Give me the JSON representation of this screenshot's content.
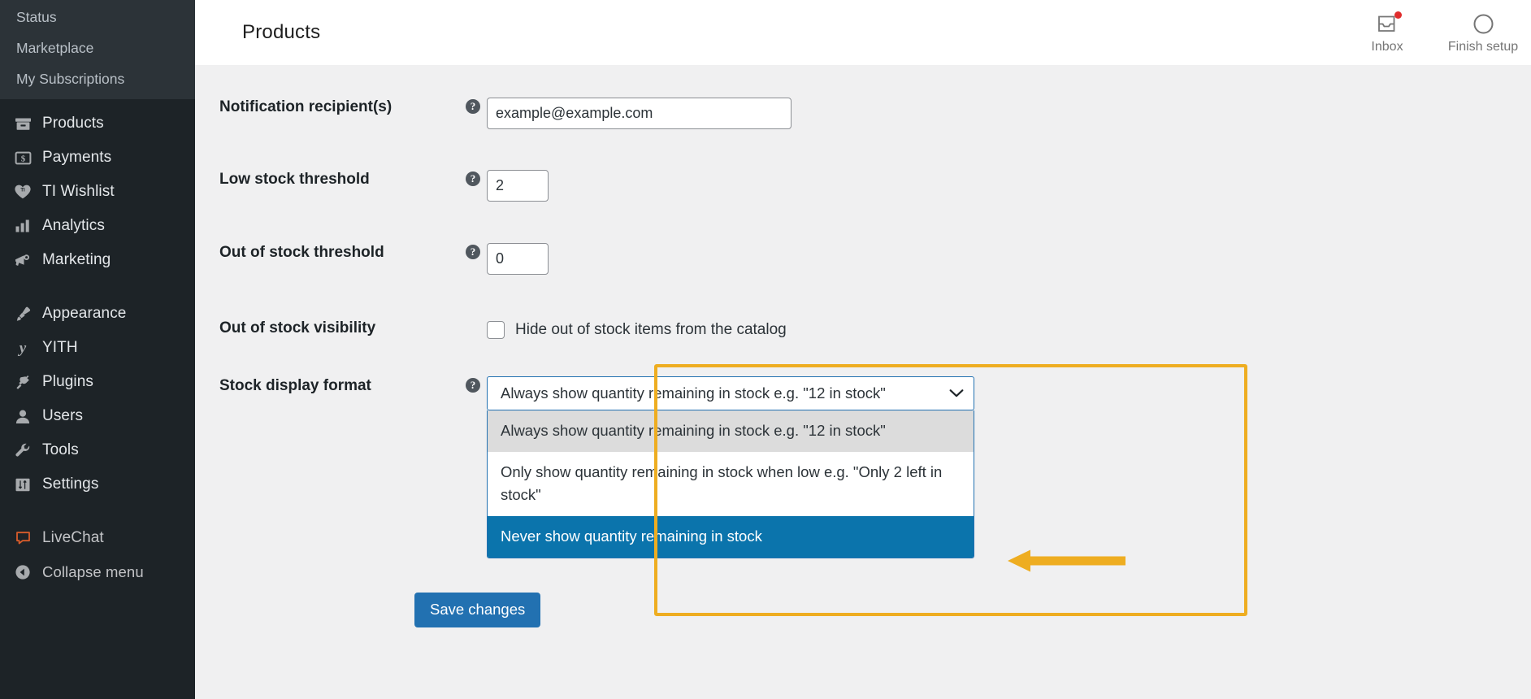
{
  "sidebar": {
    "submenu": [
      {
        "label": "Status"
      },
      {
        "label": "Marketplace"
      },
      {
        "label": "My Subscriptions"
      }
    ],
    "main_items": [
      {
        "label": "Products",
        "icon": "products-icon"
      },
      {
        "label": "Payments",
        "icon": "payments-dollar-icon"
      },
      {
        "label": "TI Wishlist",
        "icon": "heart-wishlist-icon"
      },
      {
        "label": "Analytics",
        "icon": "bar-chart-icon"
      },
      {
        "label": "Marketing",
        "icon": "megaphone-icon"
      }
    ],
    "admin_items": [
      {
        "label": "Appearance",
        "icon": "paintbrush-icon"
      },
      {
        "label": "YITH",
        "icon": "yith-logo-icon"
      },
      {
        "label": "Plugins",
        "icon": "plug-icon"
      },
      {
        "label": "Users",
        "icon": "user-icon"
      },
      {
        "label": "Tools",
        "icon": "wrench-icon"
      },
      {
        "label": "Settings",
        "icon": "sliders-icon"
      }
    ],
    "footer_items": [
      {
        "label": "LiveChat",
        "icon": "chat-bubble-icon"
      },
      {
        "label": "Collapse menu",
        "icon": "collapse-arrow-icon"
      }
    ]
  },
  "header": {
    "title": "Products",
    "actions": [
      {
        "label": "Inbox",
        "icon": "inbox-icon",
        "has_badge": true
      },
      {
        "label": "Finish setup",
        "icon": "progress-circle-icon",
        "has_badge": false
      }
    ]
  },
  "form": {
    "notification_recipients": {
      "label": "Notification recipient(s)",
      "help": "?",
      "value": "example@example.com",
      "placeholder": "example@example.com"
    },
    "low_stock_threshold": {
      "label": "Low stock threshold",
      "help": "?",
      "value": "2",
      "placeholder": "2"
    },
    "out_of_stock_threshold": {
      "label": "Out of stock threshold",
      "help": "?",
      "value": "0",
      "placeholder": "0"
    },
    "out_of_stock_visibility": {
      "label": "Out of stock visibility",
      "checkbox_label": "Hide out of stock items from the catalog",
      "checked": false
    },
    "stock_display_format": {
      "label": "Stock display format",
      "help": "?",
      "selected_value": "Always show quantity remaining in stock e.g. \"12 in stock\"",
      "options": [
        {
          "label": "Always show quantity remaining in stock e.g. \"12 in stock\"",
          "state": "hover"
        },
        {
          "label": "Only show quantity remaining in stock when low e.g. \"Only 2 left in stock\"",
          "state": "normal"
        },
        {
          "label": "Never show quantity remaining in stock",
          "state": "selected"
        }
      ]
    },
    "save": {
      "label": "Save changes"
    }
  },
  "annotation": {
    "box_color": "#eead21",
    "arrow_color": "#eead21",
    "target_option": "Never show quantity remaining in stock"
  },
  "colors": {
    "sidebar_bg": "#1d2327",
    "submenu_bg": "#2c3338",
    "accent_blue": "#2271b1",
    "selected_option_blue": "#0b74ac",
    "content_bg": "#f0f0f1",
    "badge_red": "#e02d2d"
  }
}
